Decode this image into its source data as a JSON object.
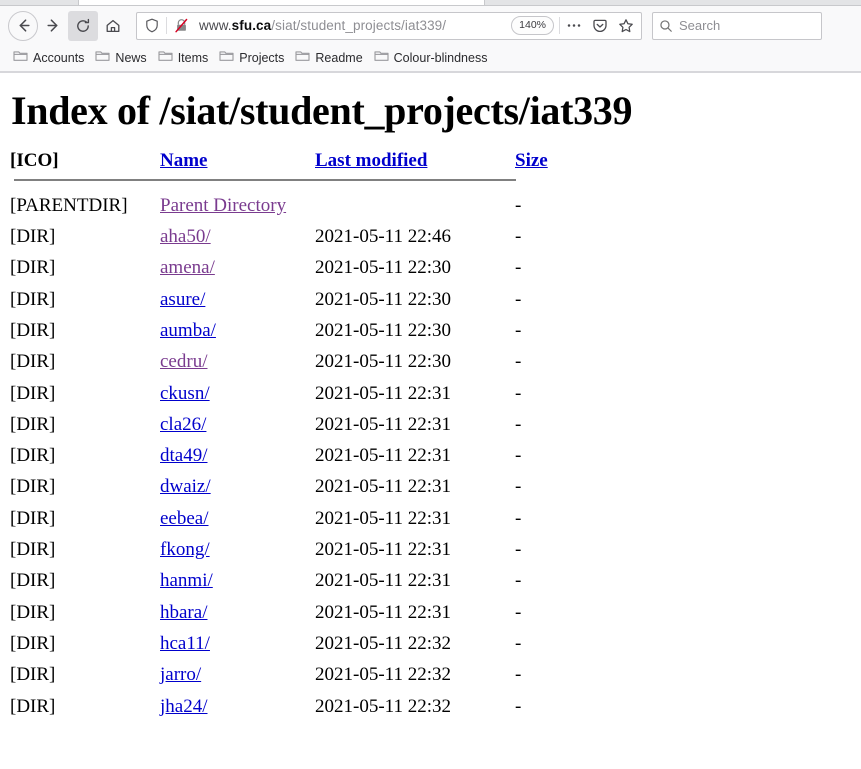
{
  "browser": {
    "nav": {
      "back_icon": "back-arrow-icon",
      "forward_icon": "forward-arrow-icon",
      "reload_icon": "reload-icon",
      "home_icon": "home-icon"
    },
    "urlbar": {
      "shield_icon": "tracking-protection-shield-icon",
      "lock_icon": "insecure-connection-icon",
      "url_prefix": "www.",
      "url_host": "sfu.ca",
      "url_path": "/siat/student_projects/iat339/",
      "full_url": "www.sfu.ca/siat/student_projects/iat339/",
      "zoom_level": "140%",
      "page_actions_icon": "ellipsis-icon",
      "pocket_icon": "pocket-icon",
      "bookmark_icon": "star-icon"
    },
    "search": {
      "icon": "search-icon",
      "placeholder": "Search",
      "value": ""
    },
    "bookmarks": [
      {
        "label": "Accounts",
        "icon": "folder-icon"
      },
      {
        "label": "News",
        "icon": "folder-icon"
      },
      {
        "label": "Items",
        "icon": "folder-icon"
      },
      {
        "label": "Projects",
        "icon": "folder-icon"
      },
      {
        "label": "Readme",
        "icon": "folder-icon"
      },
      {
        "label": "Colour-blindness",
        "icon": "folder-icon"
      }
    ]
  },
  "page": {
    "title": "Index of /siat/student_projects/iat339",
    "table": {
      "headers": {
        "icon": "[ICO]",
        "name": "Name",
        "last_modified": "Last modified",
        "size": "Size"
      },
      "rows": [
        {
          "icon": "[PARENTDIR]",
          "name": "Parent Directory",
          "date": "",
          "size": "-",
          "visited": true
        },
        {
          "icon": "[DIR]",
          "name": "aha50/",
          "date": "2021-05-11 22:46",
          "size": "-",
          "visited": true
        },
        {
          "icon": "[DIR]",
          "name": "amena/",
          "date": "2021-05-11 22:30",
          "size": "-",
          "visited": true
        },
        {
          "icon": "[DIR]",
          "name": "asure/",
          "date": "2021-05-11 22:30",
          "size": "-",
          "visited": false
        },
        {
          "icon": "[DIR]",
          "name": "aumba/",
          "date": "2021-05-11 22:30",
          "size": "-",
          "visited": false
        },
        {
          "icon": "[DIR]",
          "name": "cedru/",
          "date": "2021-05-11 22:30",
          "size": "-",
          "visited": true
        },
        {
          "icon": "[DIR]",
          "name": "ckusn/",
          "date": "2021-05-11 22:31",
          "size": "-",
          "visited": false
        },
        {
          "icon": "[DIR]",
          "name": "cla26/",
          "date": "2021-05-11 22:31",
          "size": "-",
          "visited": false
        },
        {
          "icon": "[DIR]",
          "name": "dta49/",
          "date": "2021-05-11 22:31",
          "size": "-",
          "visited": false
        },
        {
          "icon": "[DIR]",
          "name": "dwaiz/",
          "date": "2021-05-11 22:31",
          "size": "-",
          "visited": false
        },
        {
          "icon": "[DIR]",
          "name": "eebea/",
          "date": "2021-05-11 22:31",
          "size": "-",
          "visited": false
        },
        {
          "icon": "[DIR]",
          "name": "fkong/",
          "date": "2021-05-11 22:31",
          "size": "-",
          "visited": false
        },
        {
          "icon": "[DIR]",
          "name": "hanmi/",
          "date": "2021-05-11 22:31",
          "size": "-",
          "visited": false
        },
        {
          "icon": "[DIR]",
          "name": "hbara/",
          "date": "2021-05-11 22:31",
          "size": "-",
          "visited": false
        },
        {
          "icon": "[DIR]",
          "name": "hca11/",
          "date": "2021-05-11 22:32",
          "size": "-",
          "visited": false
        },
        {
          "icon": "[DIR]",
          "name": "jarro/",
          "date": "2021-05-11 22:32",
          "size": "-",
          "visited": false
        },
        {
          "icon": "[DIR]",
          "name": "jha24/",
          "date": "2021-05-11 22:32",
          "size": "-",
          "visited": false
        }
      ]
    }
  },
  "colors": {
    "link": "#0000cc",
    "visited_link": "#7a3b8f",
    "chrome_bg": "#f9f9fa"
  }
}
